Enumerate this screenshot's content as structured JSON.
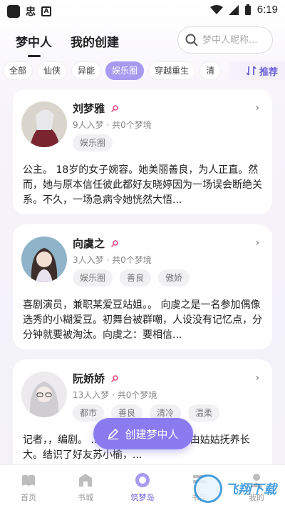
{
  "status_bar": {
    "app_glyph": "忠",
    "a_glyph": "A",
    "time": "6:19"
  },
  "header": {
    "tabs": [
      {
        "label": "梦中人",
        "active": true
      },
      {
        "label": "我的创建",
        "active": false
      }
    ]
  },
  "search": {
    "placeholder": "梦中人昵称..."
  },
  "categories": [
    {
      "label": "全部",
      "active": false
    },
    {
      "label": "仙侠",
      "active": false
    },
    {
      "label": "异能",
      "active": false
    },
    {
      "label": "娱乐圈",
      "active": true
    },
    {
      "label": "穿越重生",
      "active": false
    },
    {
      "label": "清",
      "active": false
    }
  ],
  "sort": {
    "label": "推荐"
  },
  "cards": [
    {
      "name": "刘梦雅",
      "meta": "9人入梦 · 共0个梦境",
      "tags": [
        "娱乐圈"
      ],
      "description": "公主。 18岁的女子婉容。她美丽善良，为人正直。然而，她与原本信任彼此都好友晓婷因为一场误会断绝关系。不久，一场急病令她恍然大悟..."
    },
    {
      "name": "向虞之",
      "meta": "3人入梦 · 共0个梦境",
      "tags": [
        "娱乐圈",
        "善良",
        "傲娇"
      ],
      "description": "喜剧演员，兼职某爱豆站姐。。 向虞之是一名参加偶像选秀的小糊爱豆。初舞台被群嘲，人设没有记忆点，分分钟就要被淘汰。向虞之：要相信..."
    },
    {
      "name": "阮娇娇",
      "meta": "13人入梦 · 共0个梦境",
      "tags": [
        "都市",
        "善良",
        "清冷",
        "温柔"
      ],
      "description": "记者，，编剧。 ...断。从小失去父母，由姑姑抚养长大。结识了好友苏小榆，..."
    }
  ],
  "fab": {
    "label": "创建梦中人"
  },
  "bottom_nav": [
    {
      "label": "首页",
      "active": false
    },
    {
      "label": "书城",
      "active": false
    },
    {
      "label": "筑梦岛",
      "active": true
    },
    {
      "label": "书架",
      "active": false
    },
    {
      "label": "我的",
      "active": false
    }
  ],
  "watermark": {
    "text": "飞翔下载"
  },
  "colors": {
    "accent": "#8a7cf0",
    "chip_active": "#a79af0",
    "gender_icon": "#e0457b"
  }
}
